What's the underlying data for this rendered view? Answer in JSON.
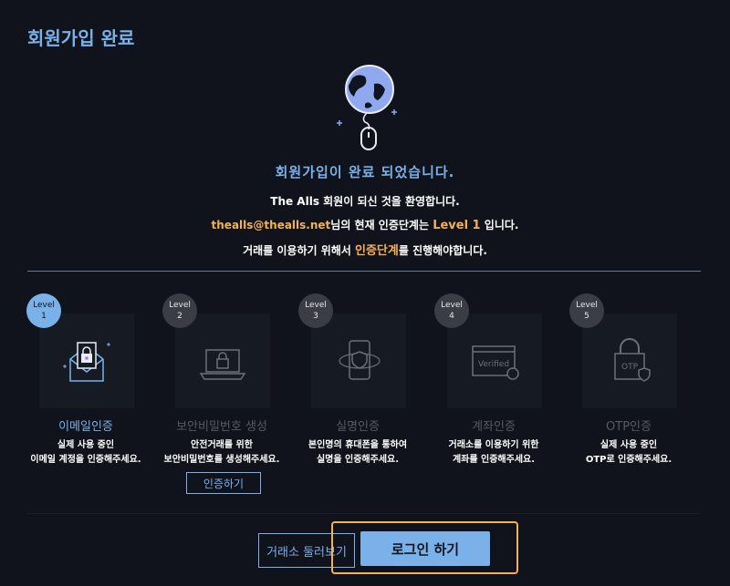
{
  "page": {
    "title": "회원가입 완료"
  },
  "hero": {
    "icon": "globe-mouse-icon",
    "headline": "회원가입이 완료 되었습니다.",
    "welcome": "The Alls 회원이 되신 것을 환영합니다.",
    "email": "thealls@thealls.net",
    "level_text_pre": "님의 현재 인증단계는 ",
    "level_value": "Level 1",
    "level_text_post": " 입니다.",
    "cta_pre": "거래를 이용하기 위해서 ",
    "cta_highlight": "인증단계",
    "cta_post": "를 진행해야합니다."
  },
  "levels": [
    {
      "badge_top": "Level",
      "badge_num": "1",
      "title": "이메일인증",
      "desc1": "실제 사용 중인",
      "desc2": "이메일 계정을 인증해주세요.",
      "icon": "envelope-lock-icon",
      "active": true
    },
    {
      "badge_top": "Level",
      "badge_num": "2",
      "title": "보안비밀번호 생성",
      "desc1": "안전거래를 위한",
      "desc2": "보안비밀번호를 생성해주세요.",
      "icon": "laptop-lock-icon",
      "active": false,
      "button": "인증하기"
    },
    {
      "badge_top": "Level",
      "badge_num": "3",
      "title": "실명인증",
      "desc1": "본인명의 휴대폰을 통하여",
      "desc2": "실명을 인증해주세요.",
      "icon": "phone-shield-icon",
      "active": false
    },
    {
      "badge_top": "Level",
      "badge_num": "4",
      "title": "계좌인증",
      "desc1": "거래소를 이용하기 위한",
      "desc2": "계좌를 인증해주세요.",
      "icon": "verified-card-icon",
      "verified_text": "Verified",
      "active": false
    },
    {
      "badge_top": "Level",
      "badge_num": "5",
      "title": "OTP인증",
      "desc1": "실제 사용 중인",
      "desc2": "OTP로 인증해주세요.",
      "icon": "otp-lock-icon",
      "otp_text": "OTP",
      "active": false
    }
  ],
  "footer": {
    "browse_label": "거래소 둘러보기",
    "login_label": "로그인 하기"
  },
  "colors": {
    "accent": "#7ab1e8",
    "highlight": "#f3b251",
    "background": "#10131c"
  }
}
